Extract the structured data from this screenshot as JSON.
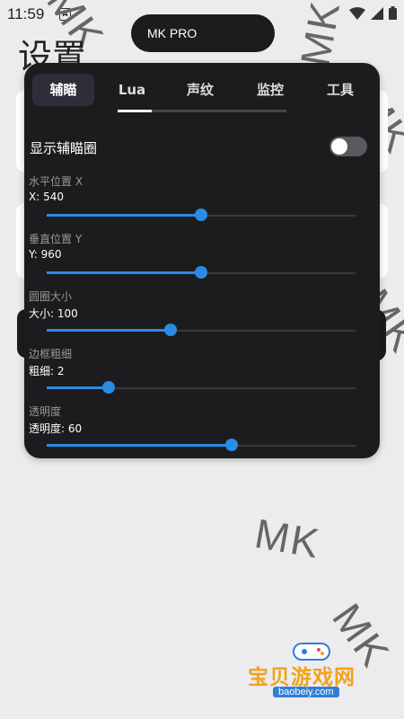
{
  "status_bar": {
    "time": "11:59",
    "notification": "A"
  },
  "watermark_text": "MK",
  "page_title": "设置",
  "floating_pill": {
    "label": "MK PRO"
  },
  "tabs": [
    {
      "label": "辅瞄",
      "active": true
    },
    {
      "label": "Lua",
      "active": false
    },
    {
      "label": "声纹",
      "active": false
    },
    {
      "label": "监控",
      "active": false
    },
    {
      "label": "工具",
      "active": false
    }
  ],
  "toggle": {
    "label": "显示辅瞄圈",
    "on": false
  },
  "sliders": [
    {
      "label": "水平位置 X",
      "value_text": "X: 540",
      "fraction": 0.5
    },
    {
      "label": "垂直位置 Y",
      "value_text": "Y: 960",
      "fraction": 0.5
    },
    {
      "label": "圆圈大小",
      "value_text": "大小: 100",
      "fraction": 0.4
    },
    {
      "label": "边框粗细",
      "value_text": "粗细: 2",
      "fraction": 0.2
    },
    {
      "label": "透明度",
      "value_text": "透明度: 60",
      "fraction": 0.6
    }
  ],
  "logo": {
    "name": "宝贝游戏网",
    "url": "baobeiy.com"
  },
  "colors": {
    "accent": "#2a8ae6",
    "panel_bg": "#1c1c1e",
    "page_bg": "#ececef",
    "logo_orange": "#f2a21a"
  }
}
